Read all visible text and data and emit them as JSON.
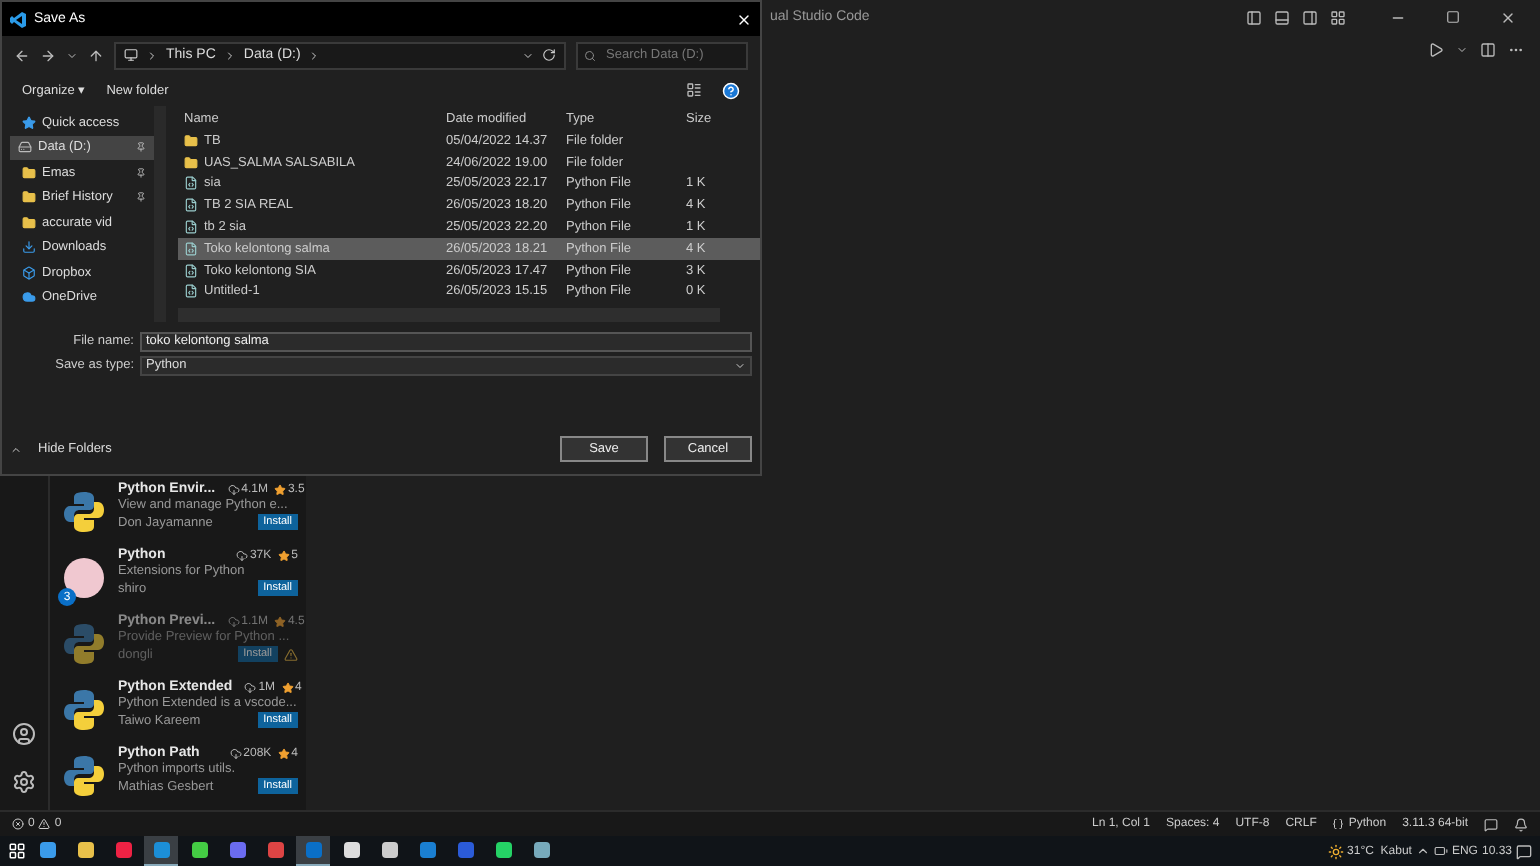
{
  "vscode": {
    "title": "ual Studio Code"
  },
  "dialog": {
    "title": "Save As",
    "breadcrumb": [
      "This PC",
      "Data (D:)"
    ],
    "search": {
      "placeholder": "Search Data (D:)"
    },
    "toolbar": [
      "Organize ▾",
      "New folder"
    ],
    "nav": [
      {
        "label": "Quick access",
        "kind": "star",
        "pinned": false,
        "selected": false
      },
      {
        "label": "Data (D:)",
        "kind": "drive",
        "pinned": true,
        "selected": true
      },
      {
        "label": "Emas",
        "kind": "folder",
        "pinned": true,
        "selected": false
      },
      {
        "label": "Brief History",
        "kind": "folder",
        "pinned": true,
        "selected": false
      },
      {
        "label": "accurate vid",
        "kind": "folder",
        "pinned": false,
        "selected": false
      },
      {
        "label": "Downloads",
        "kind": "download",
        "pinned": false,
        "selected": false
      },
      {
        "label": "Dropbox",
        "kind": "dropbox",
        "pinned": false,
        "selected": false
      },
      {
        "label": "OneDrive",
        "kind": "cloud",
        "pinned": false,
        "selected": false
      }
    ],
    "columns": [
      "Name",
      "Date modified",
      "Type",
      "Size"
    ],
    "files": [
      {
        "name": "TB",
        "date": "05/04/2022 14.37",
        "type": "File folder",
        "kind": "folder",
        "selected": false
      },
      {
        "name": "UAS_SALMA SALSABILA",
        "date": "24/06/2022 19.00",
        "type": "File folder",
        "kind": "folder",
        "selected": false
      },
      {
        "name": "sia",
        "date": "25/05/2023 22.17",
        "type": "Python File",
        "size": "1 K",
        "kind": "file",
        "selected": false
      },
      {
        "name": "TB 2 SIA REAL",
        "date": "26/05/2023 18.20",
        "type": "Python File",
        "size": "4 K",
        "kind": "file",
        "selected": false
      },
      {
        "name": "tb 2 sia",
        "date": "25/05/2023 22.20",
        "type": "Python File",
        "size": "1 K",
        "kind": "file",
        "selected": false
      },
      {
        "name": "Toko kelontong salma",
        "date": "26/05/2023 18.21",
        "type": "Python File",
        "size": "4 K",
        "kind": "file",
        "selected": true
      },
      {
        "name": "Toko kelontong SIA",
        "date": "26/05/2023 17.47",
        "type": "Python File",
        "size": "3 K",
        "kind": "file",
        "selected": false
      },
      {
        "name": "Untitled-1",
        "date": "26/05/2023 15.15",
        "type": "Python File",
        "size": "0 K",
        "kind": "file",
        "selected": false
      }
    ],
    "file_name": {
      "label": "File name:",
      "value": "toko kelontong salma"
    },
    "save_type": {
      "label": "Save as type:",
      "value": "Python"
    },
    "hide_folders": "Hide Folders",
    "buttons": [
      "Save",
      "Cancel"
    ]
  },
  "extensions": [
    {
      "name": "Python Envir...",
      "downloads": "4.1M",
      "rating": "3.5",
      "description": "View and manage Python e...",
      "author": "Don Jayamanne",
      "button": "Install",
      "disabled": false,
      "warning": false
    },
    {
      "name": "Python",
      "downloads": "37K",
      "rating": "5",
      "description": "Extensions for Python",
      "author": "shiro",
      "button": "Install",
      "disabled": false,
      "warning": false,
      "badge": "3"
    },
    {
      "name": "Python Previ...",
      "downloads": "1.1M",
      "rating": "4.5",
      "description": "Provide Preview for Python ...",
      "author": "dongli",
      "button": "Install",
      "disabled": true,
      "warning": true
    },
    {
      "name": "Python Extended",
      "downloads": "1M",
      "rating": "4",
      "description": "Python Extended is a vscode...",
      "author": "Taiwo Kareem",
      "button": "Install",
      "disabled": false,
      "warning": false
    },
    {
      "name": "Python Path",
      "downloads": "208K",
      "rating": "4",
      "description": "Python imports utils.",
      "author": "Mathias Gesbert",
      "button": "Install",
      "disabled": false,
      "warning": false
    }
  ],
  "status_bar": {
    "errors": "0",
    "warnings": "0",
    "items": [
      "Ln 1, Col 1",
      "Spaces: 4",
      "UTF-8",
      "CRLF",
      "Python",
      "3.11.3 64-bit"
    ]
  },
  "taskbar": {
    "apps": [
      {
        "selected": false
      },
      {
        "selected": false
      },
      {
        "selected": false
      },
      {
        "selected": true
      },
      {
        "selected": false
      },
      {
        "selected": false
      },
      {
        "selected": false
      },
      {
        "selected": true
      },
      {
        "selected": false
      },
      {
        "selected": false
      },
      {
        "selected": false
      },
      {
        "selected": false
      },
      {
        "selected": false
      },
      {
        "selected": false
      }
    ],
    "weather": "31°C  Kabut",
    "language": "ENG",
    "time": "10.33"
  }
}
